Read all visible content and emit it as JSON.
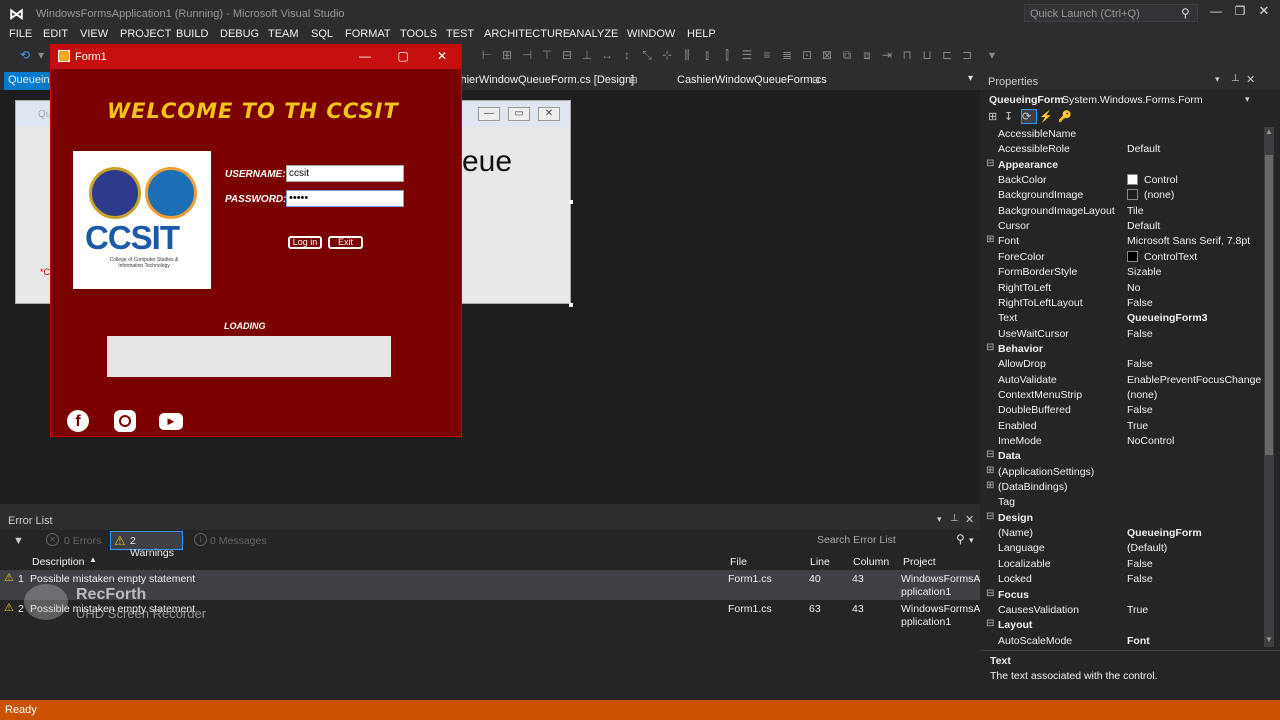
{
  "window": {
    "title": "WindowsFormsApplication1 (Running) - Microsoft Visual Studio",
    "quick_launch": "Quick Launch (Ctrl+Q)"
  },
  "menu": [
    "FILE",
    "EDIT",
    "VIEW",
    "PROJECT",
    "BUILD",
    "DEBUG",
    "TEAM",
    "SQL",
    "FORMAT",
    "TOOLS",
    "TEST",
    "ARCHITECTURE",
    "ANALYZE",
    "WINDOW",
    "HELP"
  ],
  "tabs": {
    "t0": "Queueing",
    "t1": "shierWindowQueueForm.cs [Design]",
    "t2": "CashierWindowQueueForm.cs"
  },
  "designer": {
    "partial_text": "eue",
    "partial_left": "Qu",
    "asterisk": "*C"
  },
  "form1": {
    "title": "Form1",
    "welcome": "WELCOME TO TH  CCSIT",
    "logo_text": "CCSIT",
    "logo_sub": "College of Computer Studies & Information Technology",
    "username_label": "USERNAME:",
    "username_value": "ccsit",
    "password_label": "PASSWORD:",
    "password_value": "•••••",
    "login_button": "Log in",
    "exit_button": "Exit",
    "loading_label": "LOADING"
  },
  "errorlist": {
    "title": "Error List",
    "errors_label": "0 Errors",
    "warnings_label": "2 Warnings",
    "messages_label": "0 Messages",
    "search_placeholder": "Search Error List",
    "columns": {
      "description": "Description",
      "file": "File",
      "line": "Line",
      "column": "Column",
      "project": "Project"
    },
    "rows": [
      {
        "num": "1",
        "description": "Possible mistaken empty statement",
        "file": "Form1.cs",
        "line": "40",
        "column": "43",
        "project1": "WindowsFormsA",
        "project2": "pplication1"
      },
      {
        "num": "2",
        "description": "Possible mistaken empty statement",
        "file": "Form1.cs",
        "line": "63",
        "column": "43",
        "project1": "WindowsFormsA",
        "project2": "pplication1"
      }
    ]
  },
  "watermark": {
    "brand": "RecForth",
    "sub": "UHD Screen Recorder"
  },
  "properties": {
    "title": "Properties",
    "object_name": "QueueingForm",
    "object_type": "System.Windows.Forms.Form",
    "rows": [
      {
        "kind": "prop",
        "name": "AccessibleName",
        "value": ""
      },
      {
        "kind": "prop",
        "name": "AccessibleRole",
        "value": "Default"
      },
      {
        "kind": "cat",
        "name": "Appearance"
      },
      {
        "kind": "prop",
        "name": "BackColor",
        "value": "Control",
        "swatch": "#ffffff"
      },
      {
        "kind": "prop",
        "name": "BackgroundImage",
        "value": "(none)",
        "swatch": "#1e1e1e"
      },
      {
        "kind": "prop",
        "name": "BackgroundImageLayout",
        "value": "Tile"
      },
      {
        "kind": "prop",
        "name": "Cursor",
        "value": "Default"
      },
      {
        "kind": "propx",
        "name": "Font",
        "value": "Microsoft Sans Serif, 7.8pt"
      },
      {
        "kind": "prop",
        "name": "ForeColor",
        "value": "ControlText",
        "swatch": "#000000"
      },
      {
        "kind": "prop",
        "name": "FormBorderStyle",
        "value": "Sizable"
      },
      {
        "kind": "prop",
        "name": "RightToLeft",
        "value": "No"
      },
      {
        "kind": "prop",
        "name": "RightToLeftLayout",
        "value": "False"
      },
      {
        "kind": "prop",
        "name": "Text",
        "value": "QueueingForm3",
        "bold": true
      },
      {
        "kind": "prop",
        "name": "UseWaitCursor",
        "value": "False"
      },
      {
        "kind": "cat",
        "name": "Behavior"
      },
      {
        "kind": "prop",
        "name": "AllowDrop",
        "value": "False"
      },
      {
        "kind": "prop",
        "name": "AutoValidate",
        "value": "EnablePreventFocusChange"
      },
      {
        "kind": "prop",
        "name": "ContextMenuStrip",
        "value": "(none)"
      },
      {
        "kind": "prop",
        "name": "DoubleBuffered",
        "value": "False"
      },
      {
        "kind": "prop",
        "name": "Enabled",
        "value": "True"
      },
      {
        "kind": "prop",
        "name": "ImeMode",
        "value": "NoControl"
      },
      {
        "kind": "cat",
        "name": "Data"
      },
      {
        "kind": "propx",
        "name": "(ApplicationSettings)",
        "value": ""
      },
      {
        "kind": "propx",
        "name": "(DataBindings)",
        "value": ""
      },
      {
        "kind": "prop",
        "name": "Tag",
        "value": ""
      },
      {
        "kind": "cat",
        "name": "Design"
      },
      {
        "kind": "prop",
        "name": "(Name)",
        "value": "QueueingForm",
        "bold": true
      },
      {
        "kind": "prop",
        "name": "Language",
        "value": "(Default)"
      },
      {
        "kind": "prop",
        "name": "Localizable",
        "value": "False"
      },
      {
        "kind": "prop",
        "name": "Locked",
        "value": "False"
      },
      {
        "kind": "cat",
        "name": "Focus"
      },
      {
        "kind": "prop",
        "name": "CausesValidation",
        "value": "True"
      },
      {
        "kind": "cat",
        "name": "Layout"
      },
      {
        "kind": "prop",
        "name": "AutoScaleMode",
        "value": "Font",
        "bold": true
      }
    ],
    "desc_title": "Text",
    "desc_body": "The text associated with the control."
  },
  "status": "Ready",
  "colors": {
    "accent": "#ca5100",
    "form_bg": "#7b0000",
    "form_title": "#c50f0f",
    "welcome": "#f0c419"
  }
}
